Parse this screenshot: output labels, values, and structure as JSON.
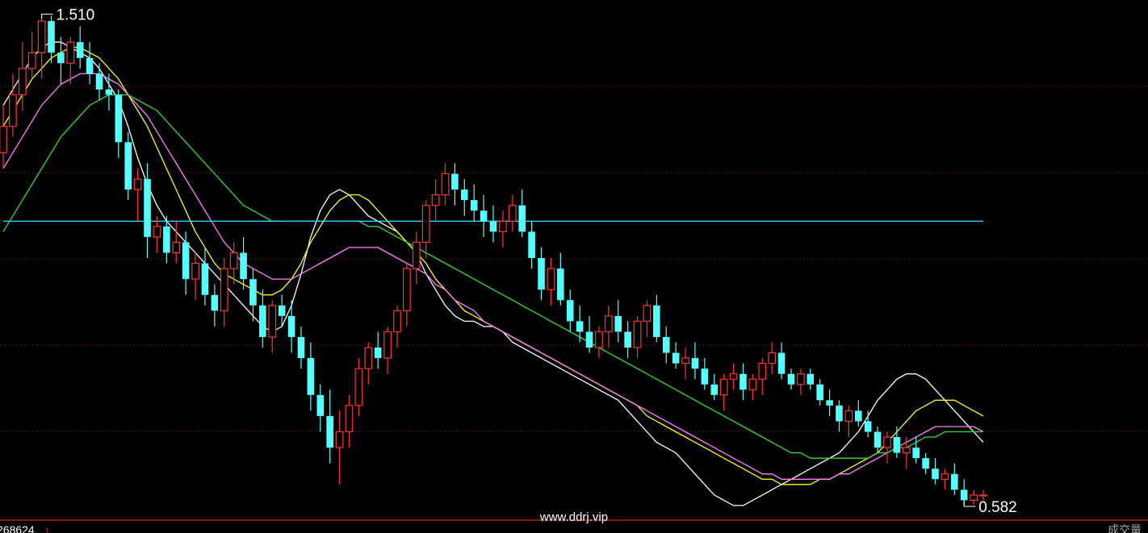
{
  "chart_data": {
    "type": "candlestick",
    "y_range": [
      0.56,
      1.54
    ],
    "high_label": "1.510",
    "low_label": "0.582",
    "candles": [
      [
        1.25,
        1.34,
        1.22,
        1.3
      ],
      [
        1.3,
        1.4,
        1.28,
        1.36
      ],
      [
        1.36,
        1.46,
        1.33,
        1.41
      ],
      [
        1.41,
        1.48,
        1.39,
        1.44
      ],
      [
        1.44,
        1.51,
        1.39,
        1.5
      ],
      [
        1.5,
        1.51,
        1.42,
        1.44
      ],
      [
        1.44,
        1.47,
        1.38,
        1.42
      ],
      [
        1.42,
        1.47,
        1.38,
        1.46
      ],
      [
        1.46,
        1.49,
        1.41,
        1.43
      ],
      [
        1.43,
        1.46,
        1.38,
        1.4
      ],
      [
        1.4,
        1.42,
        1.35,
        1.37
      ],
      [
        1.37,
        1.4,
        1.33,
        1.36
      ],
      [
        1.36,
        1.37,
        1.24,
        1.27
      ],
      [
        1.27,
        1.29,
        1.16,
        1.18
      ],
      [
        1.18,
        1.22,
        1.12,
        1.2
      ],
      [
        1.2,
        1.23,
        1.05,
        1.09
      ],
      [
        1.09,
        1.13,
        1.06,
        1.11
      ],
      [
        1.11,
        1.13,
        1.04,
        1.06
      ],
      [
        1.06,
        1.12,
        1.04,
        1.08
      ],
      [
        1.08,
        1.1,
        0.98,
        1.01
      ],
      [
        1.01,
        1.06,
        0.97,
        1.04
      ],
      [
        1.04,
        1.07,
        0.96,
        0.98
      ],
      [
        0.98,
        1.0,
        0.92,
        0.95
      ],
      [
        0.95,
        1.05,
        0.92,
        1.03
      ],
      [
        1.03,
        1.08,
        1.0,
        1.06
      ],
      [
        1.06,
        1.09,
        0.99,
        1.01
      ],
      [
        1.01,
        1.03,
        0.93,
        0.96
      ],
      [
        0.96,
        0.99,
        0.88,
        0.9
      ],
      [
        0.9,
        0.97,
        0.87,
        0.96
      ],
      [
        0.96,
        0.98,
        0.92,
        0.94
      ],
      [
        0.94,
        0.97,
        0.87,
        0.9
      ],
      [
        0.9,
        0.92,
        0.84,
        0.86
      ],
      [
        0.86,
        0.89,
        0.76,
        0.79
      ],
      [
        0.79,
        0.81,
        0.72,
        0.75
      ],
      [
        0.75,
        0.8,
        0.66,
        0.69
      ],
      [
        0.69,
        0.76,
        0.62,
        0.72
      ],
      [
        0.72,
        0.79,
        0.69,
        0.77
      ],
      [
        0.77,
        0.86,
        0.75,
        0.84
      ],
      [
        0.84,
        0.89,
        0.81,
        0.88
      ],
      [
        0.88,
        0.91,
        0.84,
        0.86
      ],
      [
        0.86,
        0.92,
        0.83,
        0.91
      ],
      [
        0.91,
        0.96,
        0.88,
        0.95
      ],
      [
        0.95,
        1.04,
        0.92,
        1.03
      ],
      [
        1.03,
        1.1,
        1.0,
        1.08
      ],
      [
        1.08,
        1.16,
        1.05,
        1.15
      ],
      [
        1.15,
        1.2,
        1.12,
        1.17
      ],
      [
        1.17,
        1.23,
        1.15,
        1.21
      ],
      [
        1.21,
        1.23,
        1.15,
        1.18
      ],
      [
        1.18,
        1.2,
        1.13,
        1.16
      ],
      [
        1.16,
        1.19,
        1.12,
        1.14
      ],
      [
        1.14,
        1.17,
        1.09,
        1.12
      ],
      [
        1.12,
        1.15,
        1.08,
        1.1
      ],
      [
        1.1,
        1.14,
        1.07,
        1.12
      ],
      [
        1.12,
        1.17,
        1.1,
        1.15
      ],
      [
        1.15,
        1.18,
        1.09,
        1.1
      ],
      [
        1.1,
        1.12,
        1.03,
        1.05
      ],
      [
        1.05,
        1.07,
        0.97,
        0.99
      ],
      [
        0.99,
        1.05,
        0.96,
        1.03
      ],
      [
        1.03,
        1.06,
        0.96,
        0.97
      ],
      [
        0.97,
        0.99,
        0.91,
        0.93
      ],
      [
        0.93,
        0.96,
        0.89,
        0.91
      ],
      [
        0.91,
        0.94,
        0.87,
        0.88
      ],
      [
        0.88,
        0.92,
        0.86,
        0.91
      ],
      [
        0.91,
        0.96,
        0.88,
        0.94
      ],
      [
        0.94,
        0.97,
        0.89,
        0.91
      ],
      [
        0.91,
        0.93,
        0.86,
        0.88
      ],
      [
        0.88,
        0.94,
        0.86,
        0.93
      ],
      [
        0.93,
        0.97,
        0.9,
        0.96
      ],
      [
        0.96,
        0.98,
        0.89,
        0.9
      ],
      [
        0.9,
        0.92,
        0.85,
        0.87
      ],
      [
        0.87,
        0.89,
        0.84,
        0.85
      ],
      [
        0.85,
        0.88,
        0.82,
        0.86
      ],
      [
        0.86,
        0.89,
        0.82,
        0.84
      ],
      [
        0.84,
        0.86,
        0.8,
        0.81
      ],
      [
        0.81,
        0.83,
        0.78,
        0.79
      ],
      [
        0.79,
        0.83,
        0.76,
        0.82
      ],
      [
        0.82,
        0.85,
        0.8,
        0.83
      ],
      [
        0.83,
        0.85,
        0.78,
        0.8
      ],
      [
        0.8,
        0.83,
        0.78,
        0.82
      ],
      [
        0.82,
        0.86,
        0.79,
        0.85
      ],
      [
        0.85,
        0.89,
        0.83,
        0.87
      ],
      [
        0.87,
        0.89,
        0.82,
        0.83
      ],
      [
        0.83,
        0.84,
        0.8,
        0.81
      ],
      [
        0.81,
        0.84,
        0.79,
        0.83
      ],
      [
        0.83,
        0.84,
        0.8,
        0.81
      ],
      [
        0.81,
        0.82,
        0.77,
        0.78
      ],
      [
        0.78,
        0.8,
        0.75,
        0.77
      ],
      [
        0.77,
        0.78,
        0.72,
        0.74
      ],
      [
        0.74,
        0.77,
        0.71,
        0.76
      ],
      [
        0.76,
        0.78,
        0.73,
        0.74
      ],
      [
        0.74,
        0.76,
        0.71,
        0.72
      ],
      [
        0.72,
        0.73,
        0.68,
        0.69
      ],
      [
        0.69,
        0.72,
        0.66,
        0.71
      ],
      [
        0.71,
        0.73,
        0.67,
        0.68
      ],
      [
        0.68,
        0.71,
        0.65,
        0.69
      ],
      [
        0.69,
        0.71,
        0.66,
        0.67
      ],
      [
        0.67,
        0.68,
        0.64,
        0.65
      ],
      [
        0.65,
        0.67,
        0.62,
        0.63
      ],
      [
        0.63,
        0.65,
        0.61,
        0.64
      ],
      [
        0.64,
        0.66,
        0.6,
        0.61
      ],
      [
        0.61,
        0.63,
        0.58,
        0.59
      ],
      [
        0.59,
        0.61,
        0.582,
        0.6
      ],
      [
        0.6,
        0.61,
        0.59,
        0.6
      ]
    ],
    "moving_averages": [
      {
        "color": "#ffffff",
        "values": [
          1.34,
          1.37,
          1.4,
          1.43,
          1.45,
          1.46,
          1.46,
          1.45,
          1.44,
          1.43,
          1.41,
          1.38,
          1.35,
          1.3,
          1.24,
          1.19,
          1.15,
          1.12,
          1.1,
          1.08,
          1.06,
          1.04,
          1.02,
          1.0,
          0.98,
          0.96,
          0.94,
          0.92,
          0.91,
          0.92,
          0.96,
          1.02,
          1.09,
          1.14,
          1.17,
          1.18,
          1.17,
          1.15,
          1.13,
          1.12,
          1.11,
          1.1,
          1.08,
          1.06,
          1.02,
          0.99,
          0.96,
          0.94,
          0.93,
          0.93,
          0.92,
          0.92,
          0.91,
          0.89,
          0.88,
          0.87,
          0.86,
          0.85,
          0.84,
          0.83,
          0.82,
          0.81,
          0.8,
          0.79,
          0.78,
          0.76,
          0.74,
          0.72,
          0.7,
          0.69,
          0.68,
          0.66,
          0.64,
          0.62,
          0.6,
          0.59,
          0.58,
          0.58,
          0.59,
          0.6,
          0.61,
          0.62,
          0.63,
          0.64,
          0.65,
          0.66,
          0.67,
          0.68,
          0.7,
          0.72,
          0.75,
          0.78,
          0.8,
          0.82,
          0.83,
          0.83,
          0.82,
          0.8,
          0.78,
          0.76,
          0.74,
          0.72,
          0.7
        ]
      },
      {
        "color": "#ffff00",
        "values": [
          1.3,
          1.33,
          1.36,
          1.39,
          1.41,
          1.43,
          1.44,
          1.45,
          1.45,
          1.44,
          1.43,
          1.41,
          1.39,
          1.36,
          1.33,
          1.3,
          1.26,
          1.22,
          1.18,
          1.14,
          1.1,
          1.07,
          1.04,
          1.02,
          1.01,
          1.0,
          0.99,
          0.98,
          0.98,
          0.99,
          1.01,
          1.04,
          1.08,
          1.11,
          1.14,
          1.16,
          1.17,
          1.17,
          1.16,
          1.14,
          1.12,
          1.1,
          1.08,
          1.06,
          1.04,
          1.01,
          0.99,
          0.97,
          0.95,
          0.94,
          0.93,
          0.92,
          0.91,
          0.9,
          0.89,
          0.88,
          0.87,
          0.86,
          0.85,
          0.84,
          0.83,
          0.82,
          0.81,
          0.8,
          0.79,
          0.78,
          0.77,
          0.75,
          0.74,
          0.73,
          0.72,
          0.71,
          0.7,
          0.69,
          0.68,
          0.67,
          0.66,
          0.65,
          0.64,
          0.63,
          0.63,
          0.62,
          0.62,
          0.62,
          0.62,
          0.63,
          0.63,
          0.64,
          0.65,
          0.66,
          0.67,
          0.68,
          0.7,
          0.72,
          0.74,
          0.76,
          0.77,
          0.78,
          0.78,
          0.78,
          0.77,
          0.76,
          0.75
        ]
      },
      {
        "color": "#ff80ff",
        "values": [
          1.22,
          1.25,
          1.28,
          1.31,
          1.34,
          1.36,
          1.38,
          1.39,
          1.4,
          1.4,
          1.4,
          1.39,
          1.38,
          1.36,
          1.34,
          1.32,
          1.29,
          1.26,
          1.23,
          1.2,
          1.17,
          1.14,
          1.11,
          1.08,
          1.06,
          1.04,
          1.03,
          1.02,
          1.01,
          1.01,
          1.01,
          1.02,
          1.03,
          1.04,
          1.05,
          1.06,
          1.07,
          1.07,
          1.07,
          1.07,
          1.06,
          1.05,
          1.04,
          1.03,
          1.02,
          1.0,
          0.99,
          0.97,
          0.96,
          0.95,
          0.93,
          0.92,
          0.91,
          0.9,
          0.89,
          0.88,
          0.87,
          0.86,
          0.85,
          0.84,
          0.83,
          0.82,
          0.81,
          0.8,
          0.79,
          0.78,
          0.77,
          0.76,
          0.75,
          0.74,
          0.73,
          0.72,
          0.71,
          0.7,
          0.69,
          0.68,
          0.67,
          0.66,
          0.65,
          0.64,
          0.64,
          0.63,
          0.63,
          0.63,
          0.63,
          0.63,
          0.63,
          0.64,
          0.64,
          0.65,
          0.66,
          0.67,
          0.68,
          0.69,
          0.7,
          0.71,
          0.72,
          0.73,
          0.73,
          0.73,
          0.73,
          0.73,
          0.72
        ]
      },
      {
        "color": "#33dd33",
        "values": [
          1.1,
          1.13,
          1.16,
          1.19,
          1.22,
          1.25,
          1.28,
          1.3,
          1.32,
          1.34,
          1.35,
          1.36,
          1.36,
          1.36,
          1.35,
          1.34,
          1.33,
          1.31,
          1.29,
          1.27,
          1.25,
          1.23,
          1.21,
          1.19,
          1.17,
          1.15,
          1.14,
          1.13,
          1.12,
          1.12,
          1.12,
          1.12,
          1.12,
          1.12,
          1.12,
          1.12,
          1.12,
          1.12,
          1.11,
          1.11,
          1.1,
          1.09,
          1.08,
          1.07,
          1.06,
          1.05,
          1.04,
          1.03,
          1.02,
          1.01,
          1.0,
          0.99,
          0.98,
          0.97,
          0.96,
          0.95,
          0.94,
          0.93,
          0.92,
          0.91,
          0.9,
          0.89,
          0.88,
          0.87,
          0.86,
          0.85,
          0.84,
          0.83,
          0.82,
          0.81,
          0.8,
          0.79,
          0.78,
          0.77,
          0.76,
          0.75,
          0.74,
          0.73,
          0.72,
          0.71,
          0.7,
          0.69,
          0.68,
          0.68,
          0.67,
          0.67,
          0.67,
          0.67,
          0.67,
          0.67,
          0.67,
          0.68,
          0.68,
          0.69,
          0.69,
          0.7,
          0.71,
          0.71,
          0.72,
          0.72,
          0.72,
          0.72,
          0.72
        ]
      },
      {
        "color": "#33ccff",
        "values": [
          1.12,
          1.12,
          1.12,
          1.12,
          1.12,
          1.12,
          1.12,
          1.12,
          1.12,
          1.12,
          1.12,
          1.12,
          1.12,
          1.12,
          1.12,
          1.12,
          1.12,
          1.12,
          1.12,
          1.12,
          1.12,
          1.12,
          1.12,
          1.12,
          1.12,
          1.12,
          1.12,
          1.12,
          1.12,
          1.12,
          1.12,
          1.12,
          1.12,
          1.12,
          1.12,
          1.12,
          1.12,
          1.12,
          1.12,
          1.12,
          1.12,
          1.12,
          1.12,
          1.12,
          1.12,
          1.12,
          1.12,
          1.12,
          1.12,
          1.12,
          1.12,
          1.12,
          1.12,
          1.12,
          1.12,
          1.12,
          1.12,
          1.12,
          1.12,
          1.12,
          1.12,
          1.12,
          1.12,
          1.12,
          1.12,
          1.12,
          1.12,
          1.12,
          1.12,
          1.12,
          1.12,
          1.12,
          1.12,
          1.12,
          1.12,
          1.12,
          1.12,
          1.12,
          1.12,
          1.12,
          1.12,
          1.12,
          1.12,
          1.12,
          1.12,
          1.12,
          1.12,
          1.12,
          1.12,
          1.12,
          1.12,
          1.12,
          1.12,
          1.12,
          1.12,
          1.12,
          1.12,
          1.12,
          1.12,
          1.12,
          1.12,
          1.12,
          1.12
        ]
      }
    ],
    "up_color": "#ff3333",
    "down_color": "#54ffff",
    "grid": true
  },
  "footer": {
    "watermark": "www.ddrj.vip",
    "left_fragment": "268624",
    "left_arrow": "↑",
    "right_fragment": "成交量"
  }
}
